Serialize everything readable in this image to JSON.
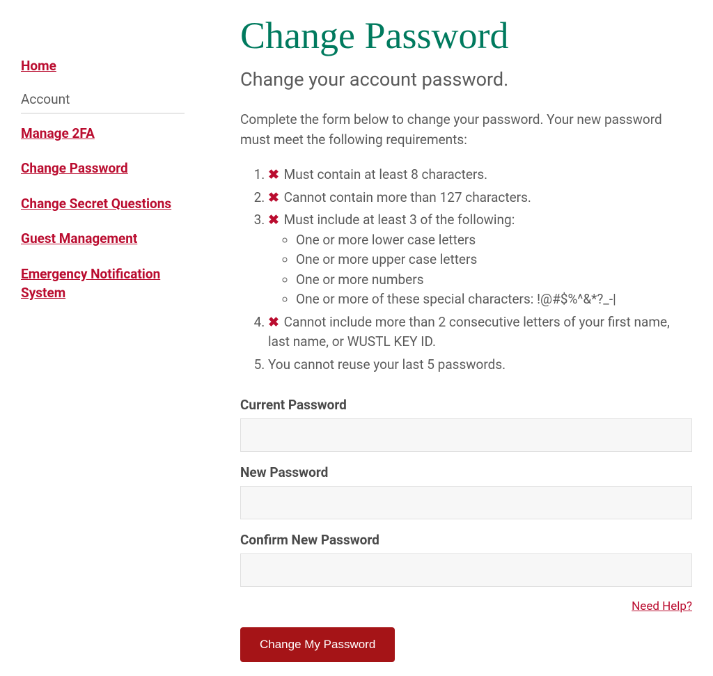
{
  "sidebar": {
    "home": "Home",
    "section_label": "Account",
    "items": [
      "Manage 2FA",
      "Change Password",
      "Change Secret Questions",
      "Guest Management",
      "Emergency Notification System"
    ]
  },
  "page": {
    "title": "Change Password",
    "subtitle": "Change your account password.",
    "instructions": "Complete the form below to change your password. Your new password must meet the following requirements:"
  },
  "requirements": {
    "r1": "Must contain at least 8 characters.",
    "r2": "Cannot contain more than 127 characters.",
    "r3": "Must include at least 3 of the following:",
    "r3_sub": [
      "One or more lower case letters",
      "One or more upper case letters",
      "One or more numbers",
      "One or more of these special characters: !@#$%^&*?_-|"
    ],
    "r4": "Cannot include more than 2 consecutive letters of your first name, last name, or WUSTL KEY ID.",
    "r5": "You cannot reuse your last 5 passwords."
  },
  "form": {
    "current_label": "Current Password",
    "new_label": "New Password",
    "confirm_label": "Confirm New Password",
    "help_link": "Need Help?",
    "submit": "Change My Password"
  }
}
